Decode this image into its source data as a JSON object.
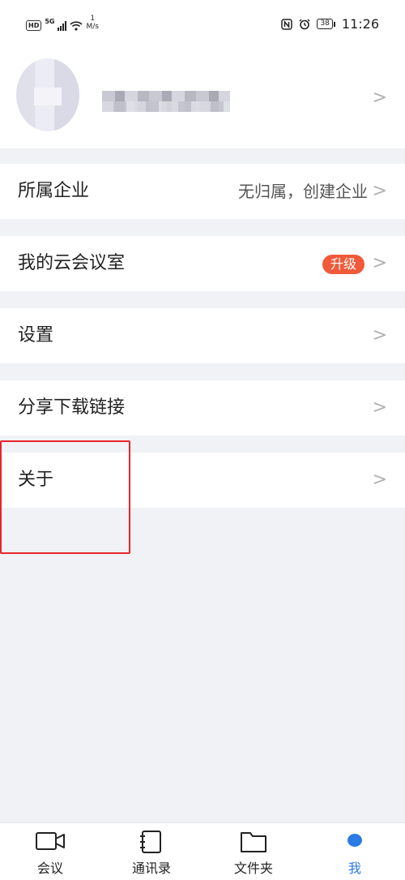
{
  "status_bar": {
    "network_type": "5G",
    "hd_label": "HD",
    "speed_value": "1",
    "speed_unit": "M/s",
    "battery": "38",
    "time": "11:26"
  },
  "profile": {
    "name_blurred": true
  },
  "menu": [
    {
      "label": "所属企业",
      "value": "无归属，创建企业"
    },
    {
      "label": "我的云会议室",
      "badge": "升级"
    },
    {
      "label": "设置"
    },
    {
      "label": "分享下载链接"
    },
    {
      "label": "关于"
    }
  ],
  "tabs": [
    {
      "label": "会议",
      "icon": "video-camera-icon"
    },
    {
      "label": "通讯录",
      "icon": "contacts-book-icon"
    },
    {
      "label": "文件夹",
      "icon": "folder-icon"
    },
    {
      "label": "我",
      "icon": "profile-icon",
      "active": true
    }
  ],
  "colors": {
    "accent": "#2b7be6",
    "badge": "#f05a3a",
    "highlight_box": "#e8252b",
    "background": "#f1f2f6"
  }
}
